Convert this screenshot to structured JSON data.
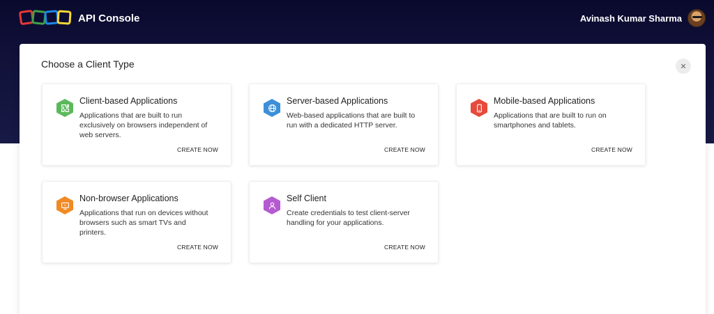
{
  "header": {
    "app_title": "API Console",
    "user_name": "Avinash Kumar Sharma"
  },
  "modal": {
    "title": "Choose a Client Type",
    "close_glyph": "✕"
  },
  "cards": [
    {
      "title": "Client-based Applications",
      "description": "Applications that are built to run exclusively on browsers independent of web servers.",
      "action": "CREATE NOW",
      "icon": "puzzle-icon",
      "color": "#5cb85c"
    },
    {
      "title": "Server-based Applications",
      "description": "Web-based applications that are built to run with a dedicated HTTP server.",
      "action": "CREATE NOW",
      "icon": "globe-icon",
      "color": "#3d8fd9"
    },
    {
      "title": "Mobile-based Applications",
      "description": "Applications that are built to run on smartphones and tablets.",
      "action": "CREATE NOW",
      "icon": "mobile-icon",
      "color": "#e64a3c"
    },
    {
      "title": "Non-browser Applications",
      "description": "Applications that run on devices without browsers such as smart TVs and printers.",
      "action": "CREATE NOW",
      "icon": "tv-icon",
      "color": "#f08a24"
    },
    {
      "title": "Self Client",
      "description": "Create credentials to test client-server handling for your applications.",
      "action": "CREATE NOW",
      "icon": "user-icon",
      "color": "#b55bd0"
    }
  ]
}
